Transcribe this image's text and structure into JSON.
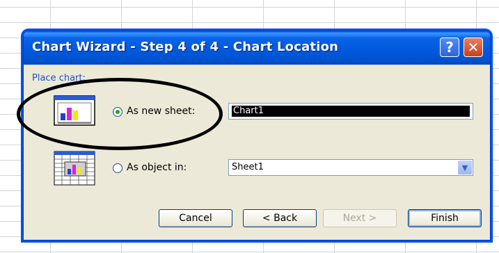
{
  "dialog": {
    "title": "Chart Wizard - Step 4 of 4 - Chart Location",
    "help_icon": "help-icon",
    "close_icon": "close-icon",
    "place_chart_label": "Place chart:"
  },
  "options": {
    "new_sheet": {
      "label": "As new sheet:",
      "checked": true,
      "value": "Chart1"
    },
    "object_in": {
      "label": "As object in:",
      "checked": false,
      "value": "Sheet1"
    }
  },
  "buttons": {
    "cancel": "Cancel",
    "back": "< Back",
    "next": "Next >",
    "finish": "Finish"
  },
  "colors": {
    "title_bar": "#0058dc",
    "dialog_bg": "#ece9d8",
    "annotation": "#000000"
  }
}
